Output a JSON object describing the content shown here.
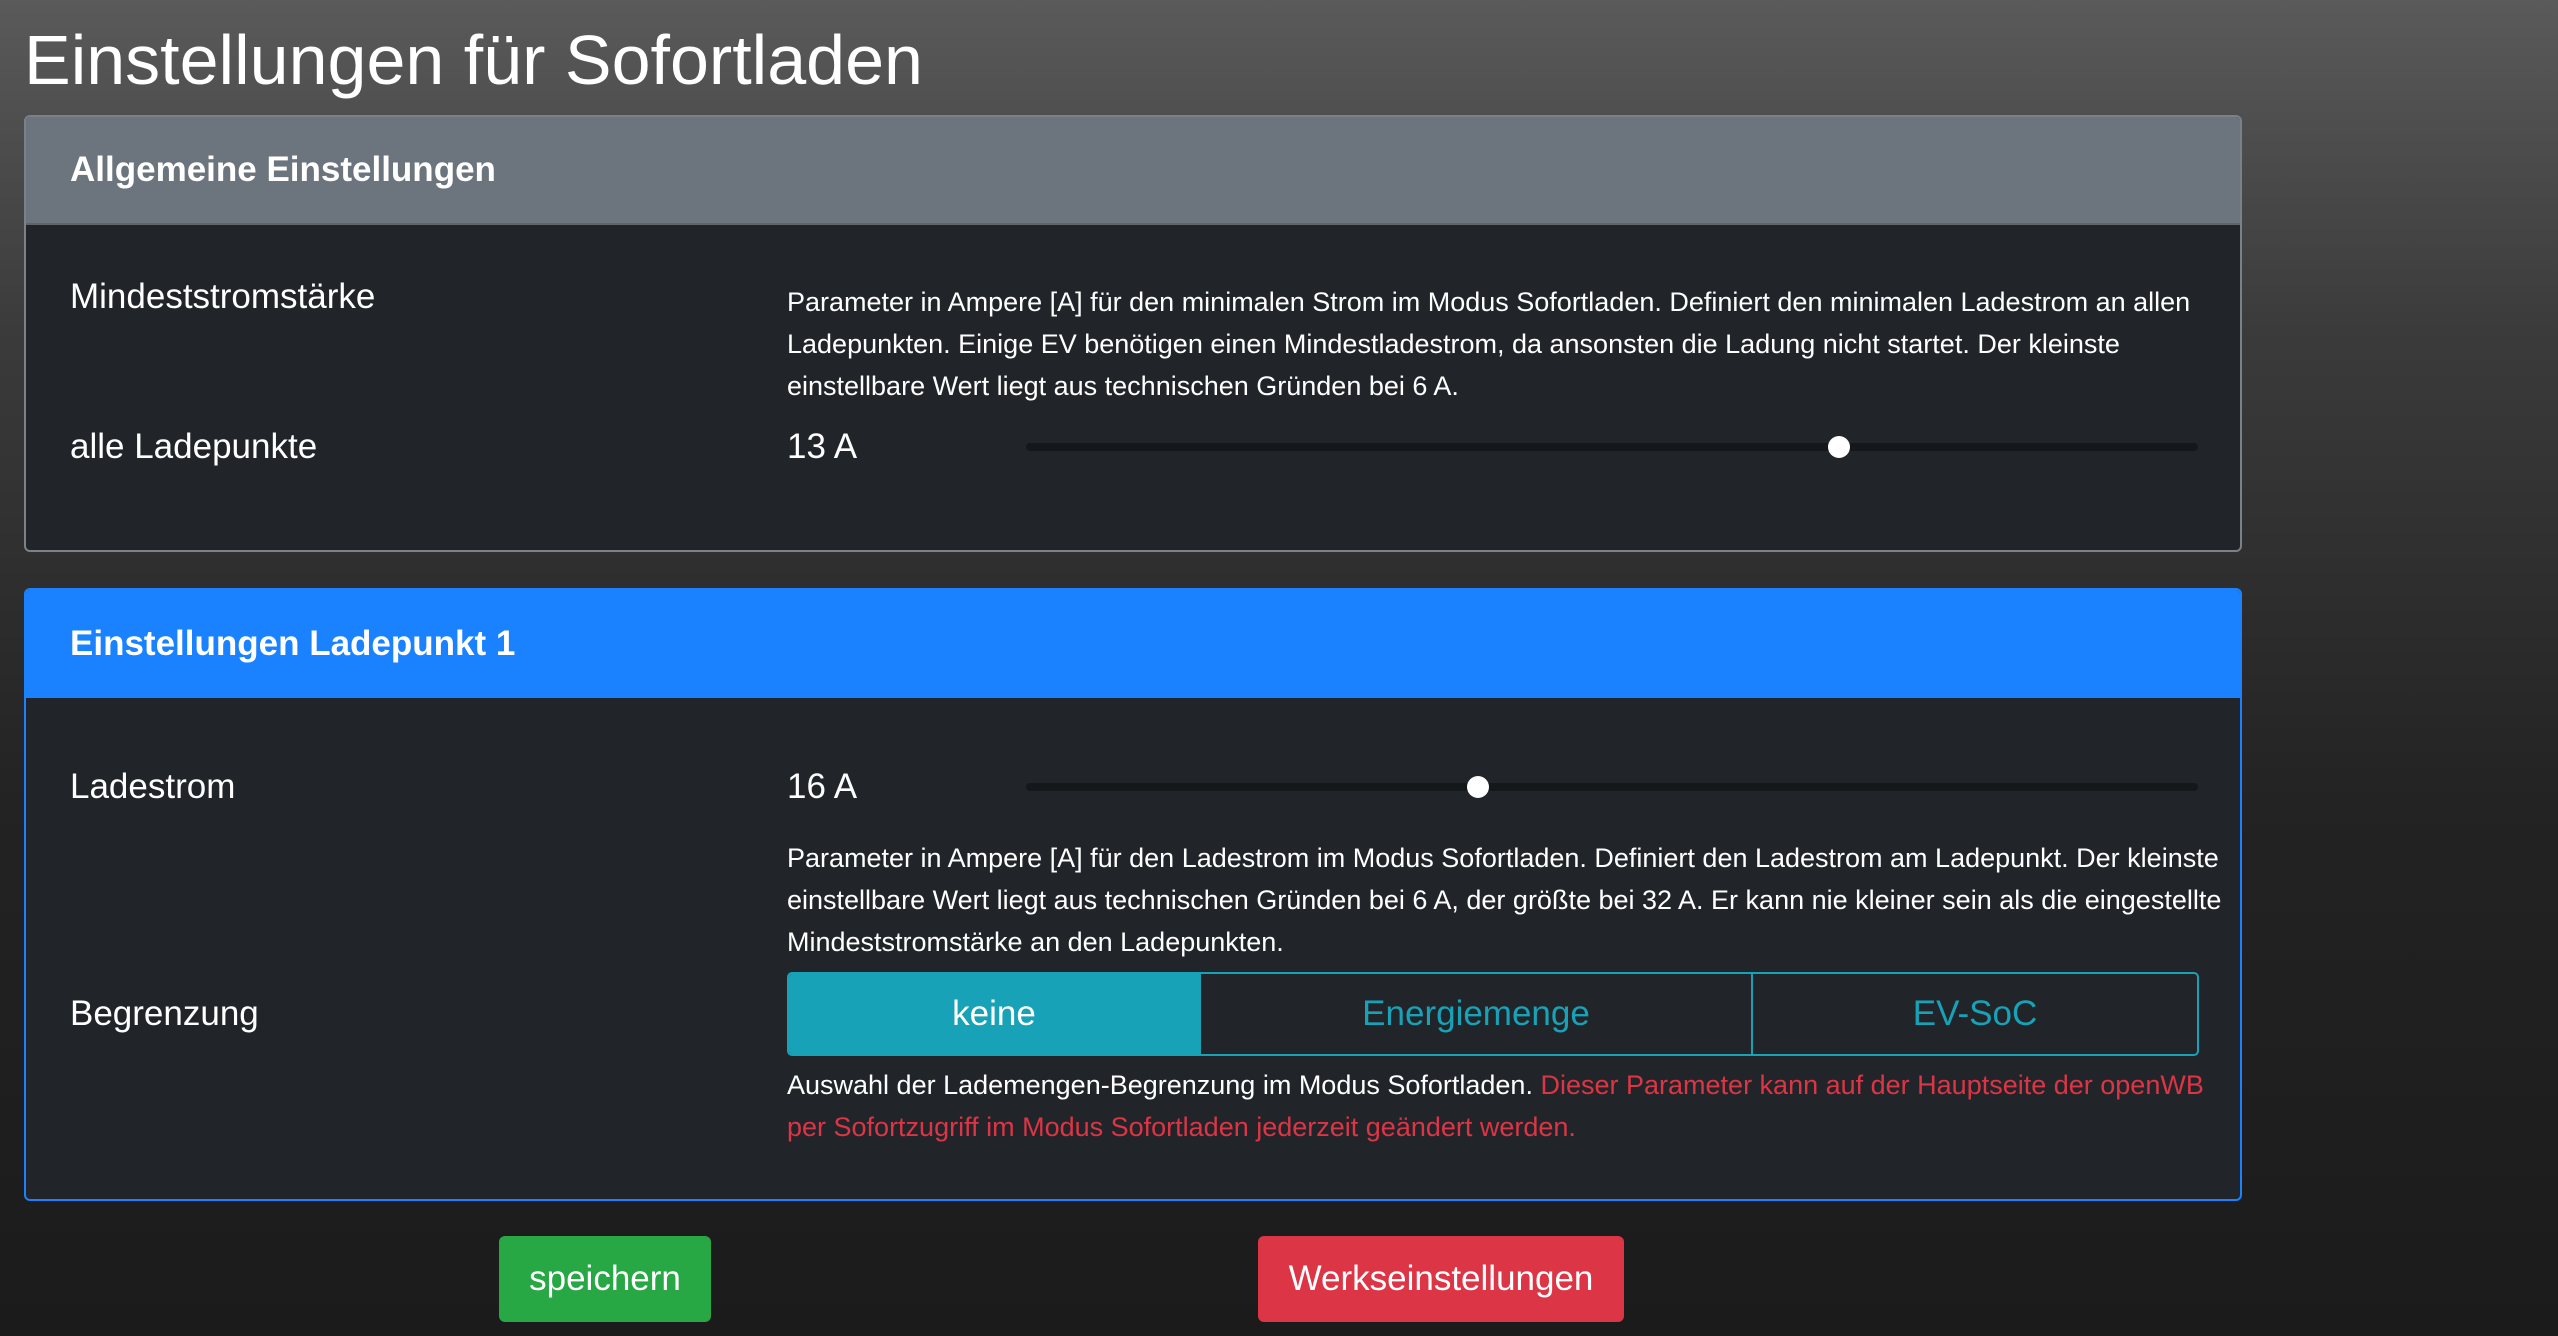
{
  "page": {
    "title": "Einstellungen für Sofortladen"
  },
  "general": {
    "header": "Allgemeine Einstellungen",
    "min_current_label": "Mindeststromstärke",
    "min_current_help": "Parameter in Ampere [A] für den minimalen Strom im Modus Sofortladen. Definiert den minimalen Ladestrom an allen Ladepunkten. Einige EV benötigen einen Mindestladestrom, da ansonsten die Ladung nicht startet. Der kleinste einstellbare Wert liegt aus technischen Gründen bei 6 A.",
    "all_points_label": "alle Ladepunkte",
    "all_points_value": "13 A",
    "all_points_slider": {
      "value": 13,
      "fraction": 0.694
    }
  },
  "lp1": {
    "header": "Einstellungen Ladepunkt 1",
    "current_label": "Ladestrom",
    "current_value": "16 A",
    "current_slider": {
      "value": 16,
      "fraction": 0.386
    },
    "current_help": "Parameter in Ampere [A] für den Ladestrom im Modus Sofortladen. Definiert den Ladestrom am Ladepunkt. Der kleinste einstellbare Wert liegt aus technischen Gründen bei 6 A, der größte bei 32 A. Er kann nie kleiner sein als die eingestellte Mindeststromstärke an den Ladepunkten.",
    "limit_label": "Begrenzung",
    "limit_options": [
      "keine",
      "Energiemenge",
      "EV-SoC"
    ],
    "limit_selected": "keine",
    "limit_help": "Auswahl der Lademengen-Begrenzung im Modus Sofortladen.",
    "limit_warning": "Dieser Parameter kann auf der Hauptseite der openWB per Sofortzugriff im Modus Sofortladen jederzeit geändert werden."
  },
  "actions": {
    "save_label": "speichern",
    "reset_label": "Werkseinstellungen"
  },
  "colors": {
    "primary": "#1a82ff",
    "secondary": "#6c757d",
    "info": "#17a2b8",
    "success": "#28a745",
    "danger": "#dc3545",
    "card_bg": "#212529"
  }
}
